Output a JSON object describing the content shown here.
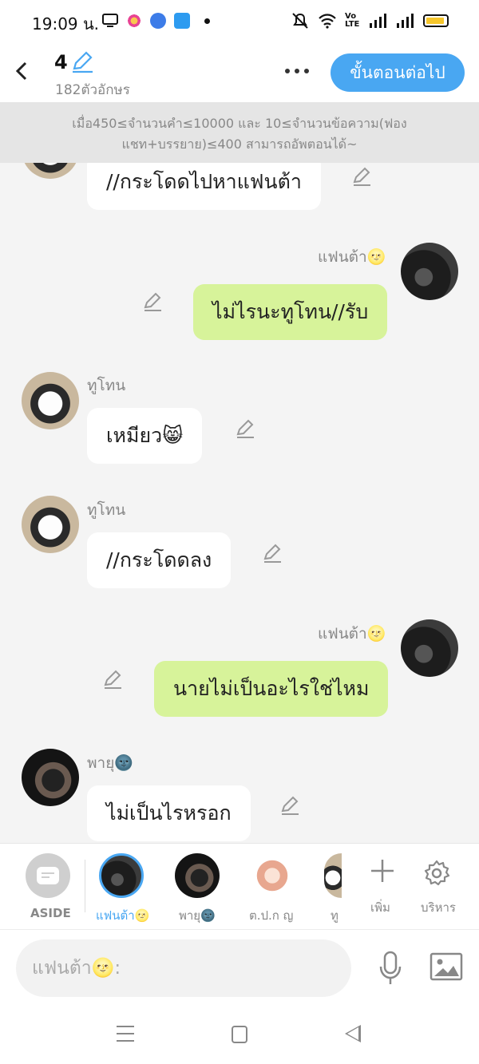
{
  "status_bar": {
    "time": "19:09 น.",
    "network_label": "Vo LTE",
    "icons": [
      "screen-icon",
      "flower-icon",
      "blue-app-icon",
      "novel-toon-icon",
      "dot-icon",
      "mute-icon",
      "wifi-icon",
      "signal-icon",
      "signal-icon",
      "battery-icon"
    ]
  },
  "header": {
    "episode_number": "4",
    "char_count": "182ตัวอักษร",
    "more_icon": "more-icon",
    "next_label": "ขั้นตอนต่อไป"
  },
  "notice": {
    "text": "เมื่อ450≤จำนวนคำ≤10000 และ 10≤จำนวนข้อความ(ฟองแชท+บรรยาย)≤400 สามารถอัพตอนได้~"
  },
  "messages": [
    {
      "side": "left",
      "speaker": "",
      "text": "//กระโดดไปหาแฟนต้า",
      "avatar": "cat"
    },
    {
      "side": "right",
      "speaker": "แฟนต้า🌝",
      "text": "ไม่ไรนะทูโทน//รับ",
      "avatar": "dark"
    },
    {
      "side": "left",
      "speaker": "ทูโทน",
      "text": "เหมียว😸",
      "avatar": "cat"
    },
    {
      "side": "left",
      "speaker": "ทูโทน",
      "text": "//กระโดดลง",
      "avatar": "cat"
    },
    {
      "side": "right",
      "speaker": "แฟนต้า🌝",
      "text": "นายไม่เป็นอะไรใช่ไหม",
      "avatar": "dark"
    },
    {
      "side": "left",
      "speaker": "พายุ🌚",
      "text": "ไม่เป็นไรหรอก",
      "avatar": "storm"
    }
  ],
  "character_bar": {
    "aside_label": "ASIDE",
    "characters": [
      {
        "label": "แฟนต้า🌝",
        "selected": true
      },
      {
        "label": "พายุ🌚",
        "selected": false
      },
      {
        "label": "ต.ป.ก ญ",
        "selected": false
      },
      {
        "label": "ทู",
        "selected": false
      }
    ],
    "add_label": "เพิ่ม",
    "manage_label": "บริหาร"
  },
  "input": {
    "placeholder": "แฟนต้า🌝:"
  },
  "colors": {
    "accent": "#49a7f2",
    "bubble_right": "#d7f39a",
    "bubble_left": "#ffffff",
    "background": "#f4f4f4"
  }
}
